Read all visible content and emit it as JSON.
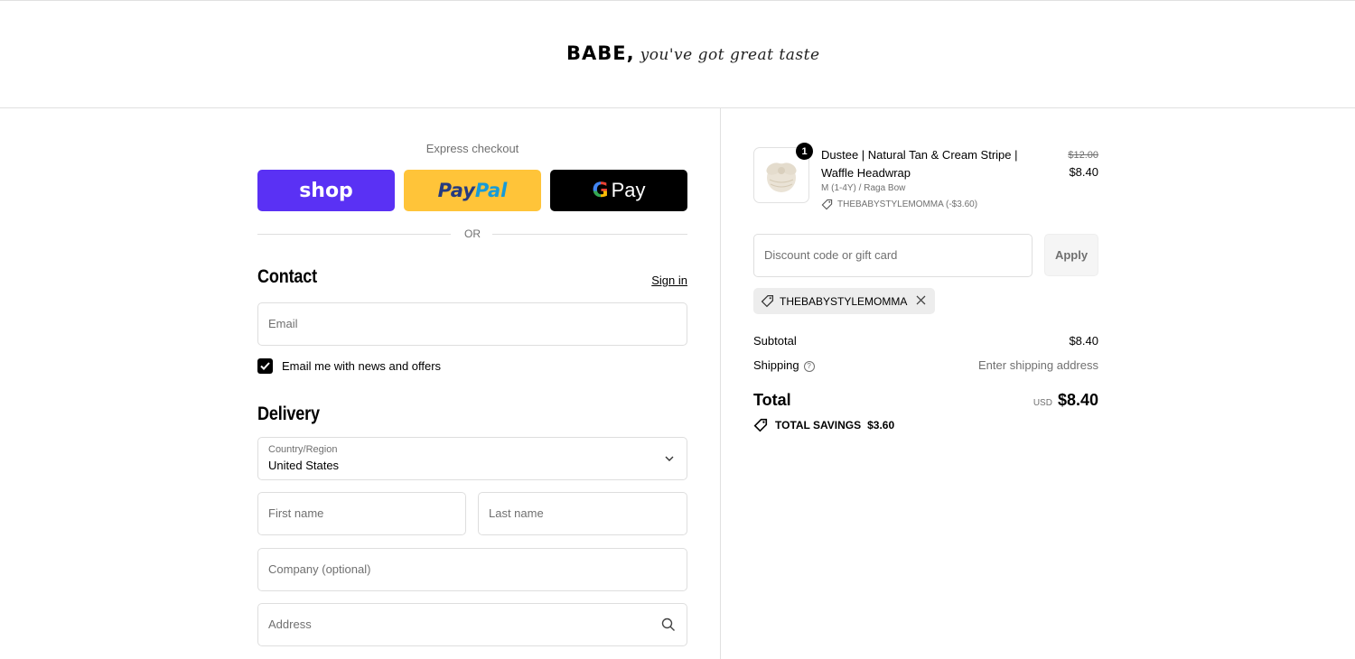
{
  "header": {
    "logo_main": "BABE,",
    "logo_script": "you've got great taste"
  },
  "express": {
    "label": "Express checkout",
    "shop_label": "shop",
    "paypal_label_a": "Pay",
    "paypal_label_b": "Pal",
    "gpay_label": "Pay",
    "or_label": "OR"
  },
  "contact": {
    "title": "Contact",
    "signin_label": "Sign in",
    "email_placeholder": "Email",
    "newsletter_label": "Email me with news and offers",
    "newsletter_checked": true
  },
  "delivery": {
    "title": "Delivery",
    "country_label": "Country/Region",
    "country_value": "United States",
    "first_name_placeholder": "First name",
    "last_name_placeholder": "Last name",
    "company_placeholder": "Company (optional)",
    "address_placeholder": "Address"
  },
  "order": {
    "item": {
      "quantity": "1",
      "title": "Dustee | Natural Tan & Cream Stripe | Waffle Headwrap",
      "variant": "M (1-4Y) / Raga Bow",
      "discount": "THEBABYSTYLEMOMMA (-$3.60)",
      "original_price": "$12.00",
      "price": "$8.40"
    },
    "discount_placeholder": "Discount code or gift card",
    "apply_label": "Apply",
    "applied_code": "THEBABYSTYLEMOMMA",
    "subtotal_label": "Subtotal",
    "subtotal_value": "$8.40",
    "shipping_label": "Shipping",
    "shipping_value": "Enter shipping address",
    "total_label": "Total",
    "currency": "USD",
    "total_value": "$8.40",
    "savings_label": "TOTAL SAVINGS",
    "savings_value": "$3.60"
  },
  "colors": {
    "shop": "#5a31f4",
    "paypal": "#ffc439",
    "gpay": "#000000"
  }
}
